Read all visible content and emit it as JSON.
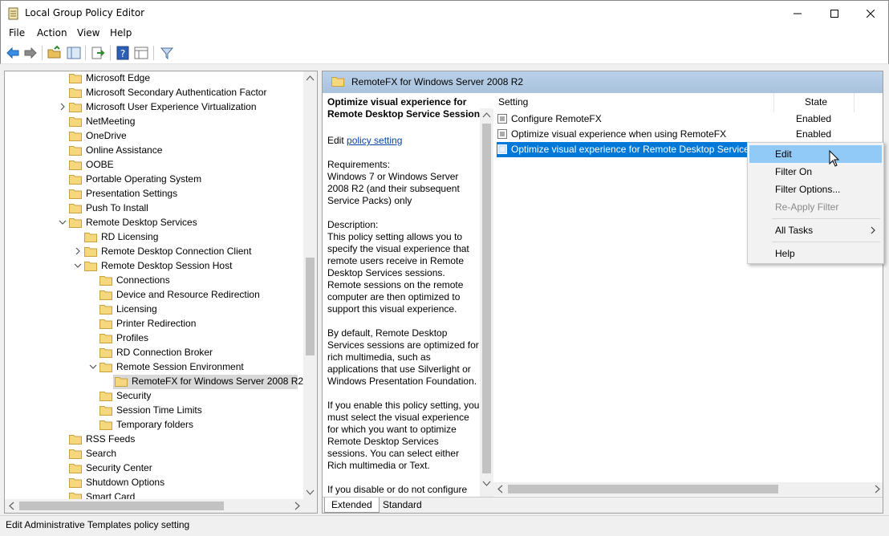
{
  "window": {
    "title": "Local Group Policy Editor"
  },
  "menu": [
    "File",
    "Action",
    "View",
    "Help"
  ],
  "tree": [
    {
      "label": "Microsoft Edge",
      "level": 0,
      "expander": "none"
    },
    {
      "label": "Microsoft Secondary Authentication Factor",
      "level": 0,
      "expander": "none"
    },
    {
      "label": "Microsoft User Experience Virtualization",
      "level": 0,
      "expander": "collapsed"
    },
    {
      "label": "NetMeeting",
      "level": 0,
      "expander": "none"
    },
    {
      "label": "OneDrive",
      "level": 0,
      "expander": "none"
    },
    {
      "label": "Online Assistance",
      "level": 0,
      "expander": "none"
    },
    {
      "label": "OOBE",
      "level": 0,
      "expander": "none"
    },
    {
      "label": "Portable Operating System",
      "level": 0,
      "expander": "none"
    },
    {
      "label": "Presentation Settings",
      "level": 0,
      "expander": "none"
    },
    {
      "label": "Push To Install",
      "level": 0,
      "expander": "none"
    },
    {
      "label": "Remote Desktop Services",
      "level": 0,
      "expander": "expanded"
    },
    {
      "label": "RD Licensing",
      "level": 1,
      "expander": "none"
    },
    {
      "label": "Remote Desktop Connection Client",
      "level": 1,
      "expander": "collapsed"
    },
    {
      "label": "Remote Desktop Session Host",
      "level": 1,
      "expander": "expanded"
    },
    {
      "label": "Connections",
      "level": 2,
      "expander": "none"
    },
    {
      "label": "Device and Resource Redirection",
      "level": 2,
      "expander": "none"
    },
    {
      "label": "Licensing",
      "level": 2,
      "expander": "none"
    },
    {
      "label": "Printer Redirection",
      "level": 2,
      "expander": "none"
    },
    {
      "label": "Profiles",
      "level": 2,
      "expander": "none"
    },
    {
      "label": "RD Connection Broker",
      "level": 2,
      "expander": "none"
    },
    {
      "label": "Remote Session Environment",
      "level": 2,
      "expander": "expanded"
    },
    {
      "label": "RemoteFX for Windows Server 2008 R2",
      "level": 3,
      "expander": "none",
      "selected": true,
      "open": true
    },
    {
      "label": "Security",
      "level": 2,
      "expander": "none"
    },
    {
      "label": "Session Time Limits",
      "level": 2,
      "expander": "none"
    },
    {
      "label": "Temporary folders",
      "level": 2,
      "expander": "none"
    },
    {
      "label": "RSS Feeds",
      "level": 0,
      "expander": "none"
    },
    {
      "label": "Search",
      "level": 0,
      "expander": "none"
    },
    {
      "label": "Security Center",
      "level": 0,
      "expander": "none"
    },
    {
      "label": "Shutdown Options",
      "level": 0,
      "expander": "none"
    },
    {
      "label": "Smart Card",
      "level": 0,
      "expander": "none"
    }
  ],
  "right": {
    "header": "RemoteFX for Windows Server 2008 R2",
    "desc_title": "Optimize visual experience for Remote Desktop Service Sessions",
    "edit_prefix": "Edit",
    "edit_link": "policy setting",
    "requirements": "Requirements:\nWindows 7 or Windows Server 2008 R2 (and their subsequent Service Packs) only",
    "description": "Description:\nThis policy setting allows you to specify the visual experience that remote users receive in Remote Desktop Services sessions. Remote sessions on the remote computer are then optimized to support this visual experience.",
    "para2": "By default, Remote Desktop Services sessions are optimized for rich multimedia, such as applications that use Silverlight or Windows Presentation Foundation.",
    "para3": "If you enable this policy setting, you must select the visual experience for which you want to optimize Remote Desktop Services sessions. You can select either Rich multimedia or Text.",
    "para4": "If you disable or do not configure",
    "col_setting": "Setting",
    "col_state": "State",
    "rows": [
      {
        "name": "Configure RemoteFX",
        "state": "Enabled"
      },
      {
        "name": "Optimize visual experience when using RemoteFX",
        "state": "Enabled"
      },
      {
        "name": "Optimize visual experience for Remote Desktop Service S",
        "state": "",
        "selected": true
      }
    ],
    "tabs": [
      "Extended",
      "Standard"
    ]
  },
  "context_menu": [
    {
      "label": "Edit",
      "highlighted": true
    },
    {
      "label": "Filter On"
    },
    {
      "label": "Filter Options..."
    },
    {
      "label": "Re-Apply Filter",
      "disabled": true
    },
    {
      "label": "All Tasks",
      "submenu": true
    },
    {
      "label": "Help"
    }
  ],
  "status": "Edit Administrative Templates policy setting",
  "colors": {
    "selection": "#0078d7",
    "menu_highlight": "#91c9f7",
    "header": "#b9d1ea"
  }
}
